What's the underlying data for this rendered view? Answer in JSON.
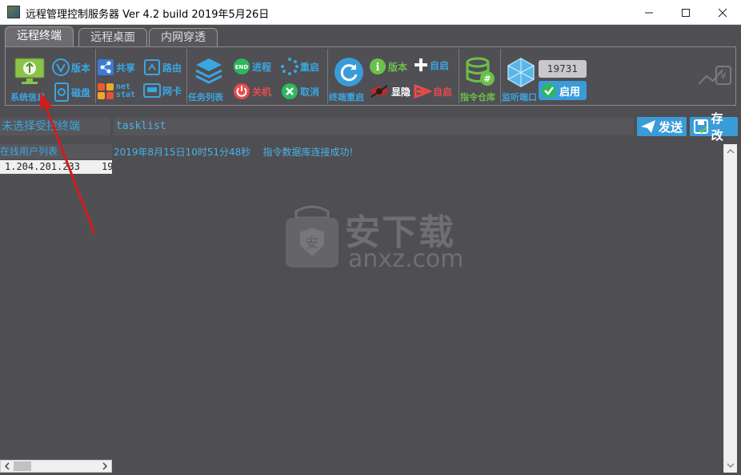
{
  "window": {
    "title": "远程管理控制服务器 Ver 4.2 build 2019年5月26日"
  },
  "tabs": [
    {
      "label": "远程终端"
    },
    {
      "label": "远程桌面"
    },
    {
      "label": "内网穿透"
    }
  ],
  "toolbar": {
    "system_info": "系统信息",
    "version": "版本",
    "disk": "磁盘",
    "share": "共享",
    "route": "路由",
    "netstat": "net stat",
    "nic": "网卡",
    "task_list": "任务列表",
    "process": "进程",
    "restart": "重启",
    "shutdown": "关机",
    "cancel": "取消",
    "terminal_restart": "终端重启",
    "version2": "版本",
    "autostart_add": "自启",
    "show_hide": "显隐",
    "autostart_remove": "自启",
    "command_repo": "指令仓库",
    "listen_port": "监听端口",
    "port_value": "19731",
    "enable": "启用"
  },
  "command": {
    "target_placeholder": "未选择受控终端",
    "input_value": "tasklist",
    "send_label": "发送",
    "save_label": "存改"
  },
  "left_panel": {
    "header": "在线用户列表",
    "users": [
      {
        "ip": "1.204.201.233",
        "port": "19"
      }
    ]
  },
  "log": {
    "entries": [
      {
        "time": "2019年8月15日10时51分48秒",
        "message": "指令数据库连接成功!"
      }
    ]
  },
  "watermark": {
    "brand": "安下载",
    "url": "anxz.com"
  },
  "colors": {
    "accent": "#3a9bd9",
    "text_blue": "#48b3ea",
    "background": "#4f4e52"
  }
}
